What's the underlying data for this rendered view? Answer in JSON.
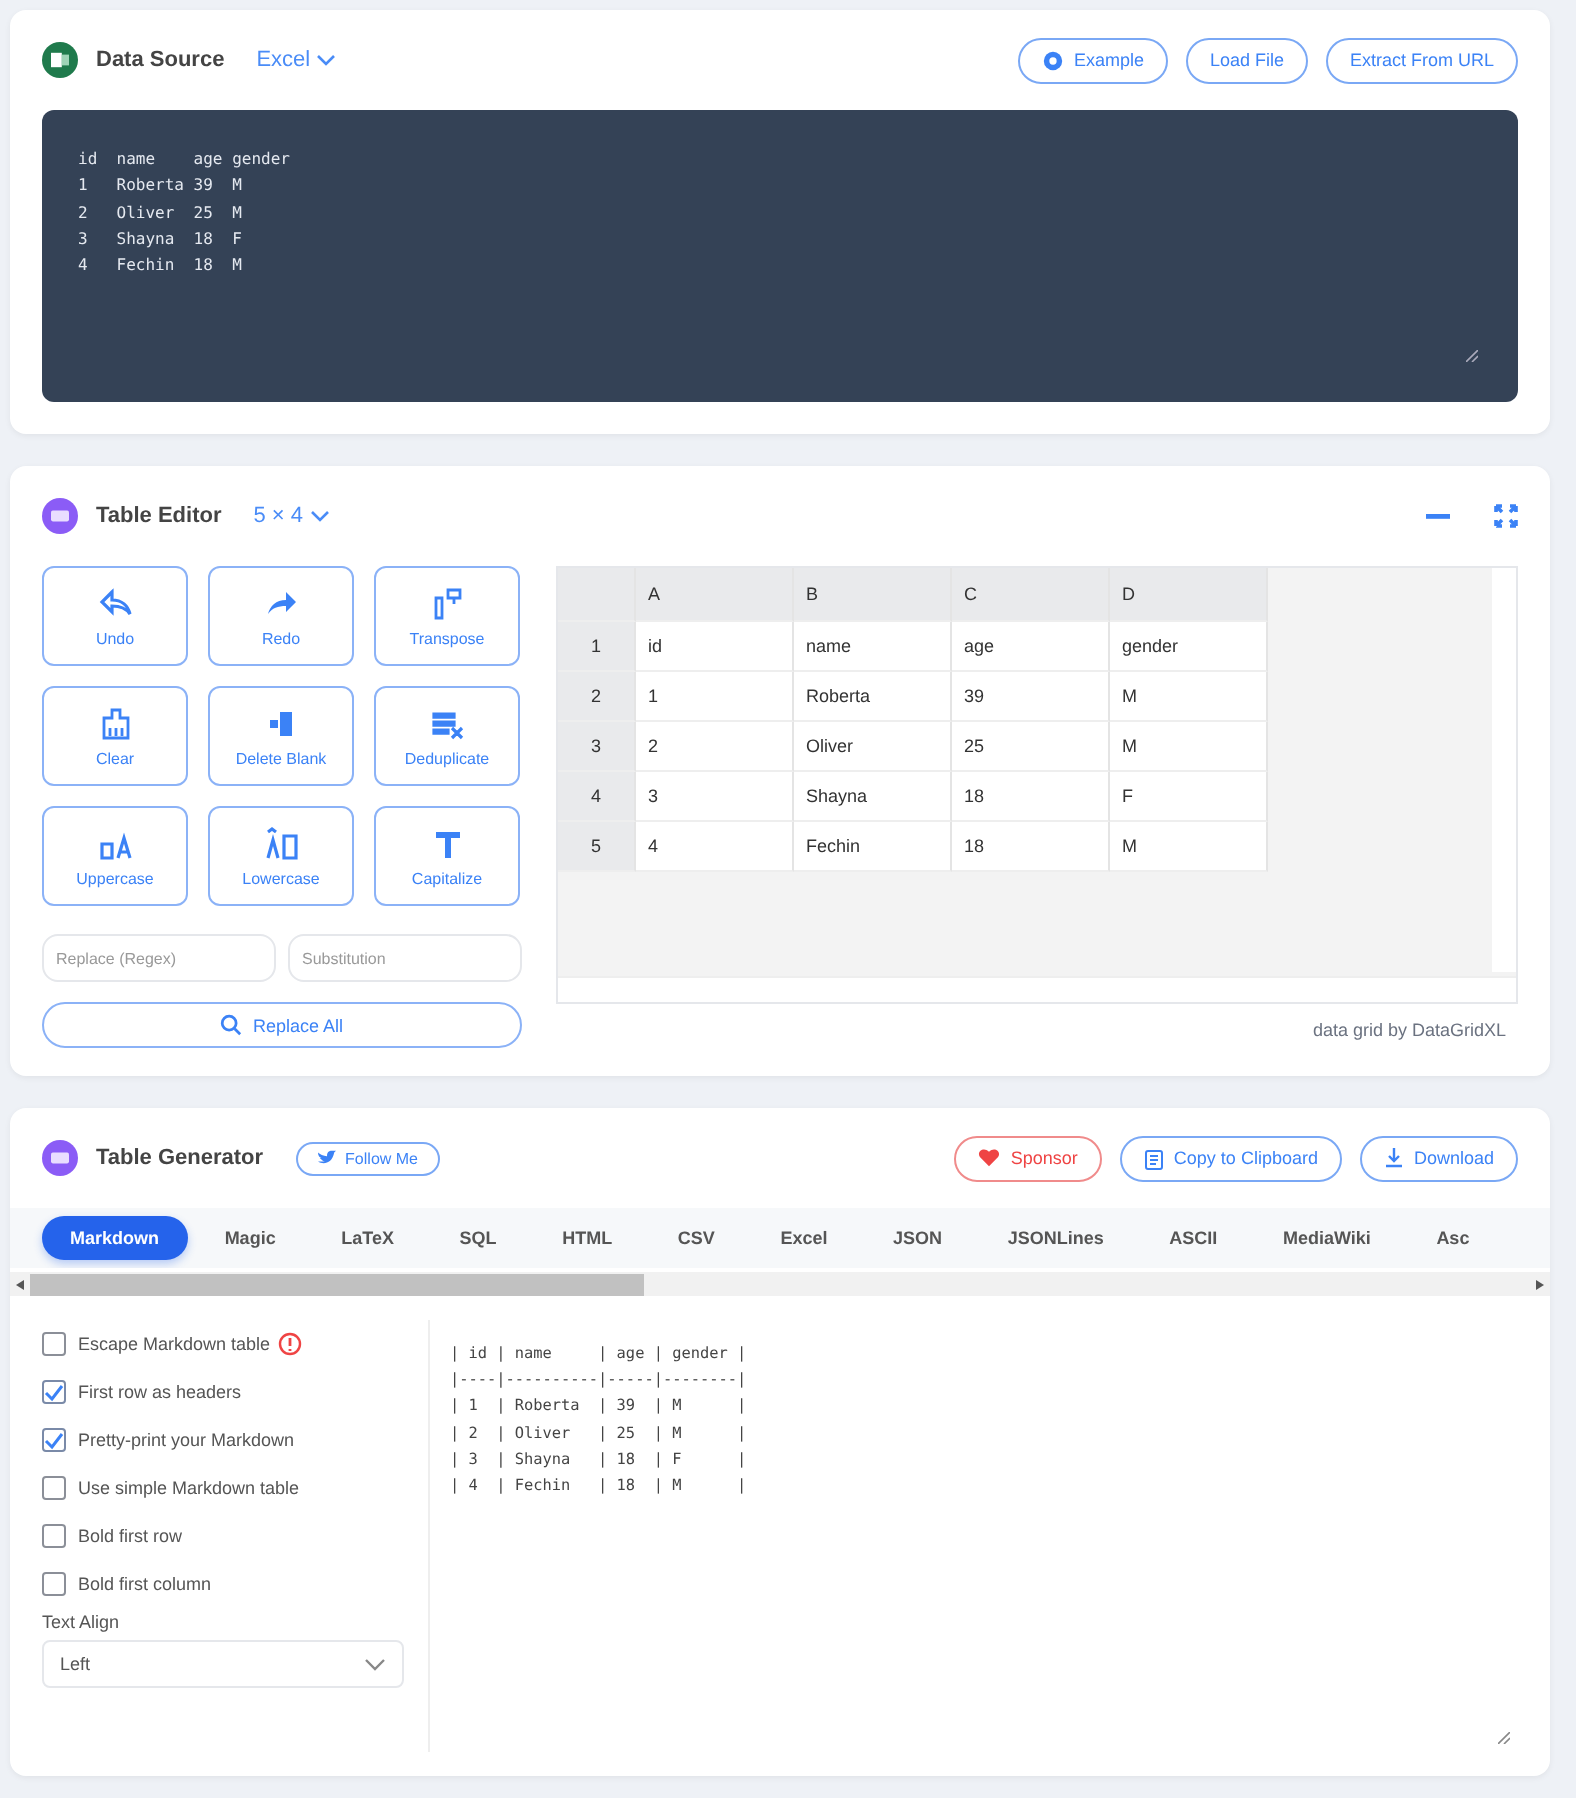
{
  "data_source": {
    "title": "Data Source",
    "format": "Excel",
    "buttons": [
      {
        "label": "Example",
        "kind": "example"
      },
      {
        "label": "Load File",
        "kind": "plain"
      },
      {
        "label": "Extract From URL",
        "kind": "plain"
      }
    ],
    "text": "id  name    age gender\n1   Roberta 39  M\n2   Oliver  25  M\n3   Shayna  18  F\n4   Fechin  18  M"
  },
  "table_editor": {
    "title": "Table Editor",
    "size": "5 × 4",
    "actions": [
      {
        "label": "Undo",
        "kind": "undo"
      },
      {
        "label": "Redo",
        "kind": "redo"
      },
      {
        "label": "Transpose",
        "kind": "transpose"
      },
      {
        "label": "Clear",
        "kind": "clear"
      },
      {
        "label": "Delete Blank",
        "kind": "delete"
      },
      {
        "label": "Deduplicate",
        "kind": "dedupe"
      },
      {
        "label": "Uppercase",
        "kind": "upper"
      },
      {
        "label": "Lowercase",
        "kind": "lower"
      },
      {
        "label": "Capitalize",
        "kind": "capitalize"
      }
    ],
    "replace_placeholder": "Replace (Regex)",
    "substitution_placeholder": "Substitution",
    "replace_button": "Replace All",
    "grid": {
      "columns": [
        "A",
        "B",
        "C",
        "D"
      ],
      "rows": [
        {
          "number": "1",
          "cells": [
            "id",
            "name",
            "age",
            "gender"
          ]
        },
        {
          "number": "2",
          "cells": [
            "1",
            "Roberta",
            "39",
            "M"
          ]
        },
        {
          "number": "3",
          "cells": [
            "2",
            "Oliver",
            "25",
            "M"
          ]
        },
        {
          "number": "4",
          "cells": [
            "3",
            "Shayna",
            "18",
            "F"
          ]
        },
        {
          "number": "5",
          "cells": [
            "4",
            "Fechin",
            "18",
            "M"
          ]
        }
      ]
    },
    "credit": "data grid by DataGridXL"
  },
  "table_generator": {
    "title": "Table Generator",
    "follow_button": "Follow Me",
    "buttons": [
      {
        "label": "Sponsor",
        "kind": "sponsor"
      },
      {
        "label": "Copy to Clipboard",
        "kind": "copy"
      },
      {
        "label": "Download",
        "kind": "download"
      }
    ],
    "tabs": [
      {
        "label": "Markdown",
        "selected": true
      },
      {
        "label": "Magic",
        "selected": false
      },
      {
        "label": "LaTeX",
        "selected": false
      },
      {
        "label": "SQL",
        "selected": false
      },
      {
        "label": "HTML",
        "selected": false
      },
      {
        "label": "CSV",
        "selected": false
      },
      {
        "label": "Excel",
        "selected": false
      },
      {
        "label": "JSON",
        "selected": false
      },
      {
        "label": "JSONLines",
        "selected": false
      },
      {
        "label": "ASCII",
        "selected": false
      },
      {
        "label": "MediaWiki",
        "selected": false
      },
      {
        "label": "Asc",
        "selected": false
      }
    ],
    "options": [
      {
        "label": "Escape Markdown table",
        "checked": false,
        "info": true
      },
      {
        "label": "First row as headers",
        "checked": true,
        "info": false
      },
      {
        "label": "Pretty-print your Markdown",
        "checked": true,
        "info": false
      },
      {
        "label": "Use simple Markdown table",
        "checked": false,
        "info": false
      },
      {
        "label": "Bold first row",
        "checked": false,
        "info": false
      },
      {
        "label": "Bold first column",
        "checked": false,
        "info": false
      }
    ],
    "text_align": {
      "label": "Text Align",
      "value": "Left"
    },
    "preview": "| id | name     | age | gender |\n|----|----------|-----|--------|\n| 1  | Roberta  | 39  | M      |\n| 2  | Oliver   | 25  | M      |\n| 3  | Shayna   | 18  | F      |\n| 4  | Fechin   | 18  | M      |"
  }
}
